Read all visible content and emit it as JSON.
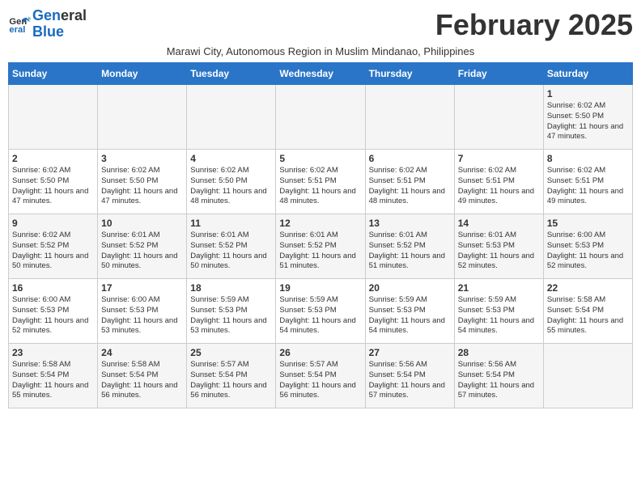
{
  "logo": {
    "line1": "General",
    "line2": "Blue"
  },
  "title": "February 2025",
  "subtitle": "Marawi City, Autonomous Region in Muslim Mindanao, Philippines",
  "days_of_week": [
    "Sunday",
    "Monday",
    "Tuesday",
    "Wednesday",
    "Thursday",
    "Friday",
    "Saturday"
  ],
  "weeks": [
    [
      {
        "day": "",
        "info": ""
      },
      {
        "day": "",
        "info": ""
      },
      {
        "day": "",
        "info": ""
      },
      {
        "day": "",
        "info": ""
      },
      {
        "day": "",
        "info": ""
      },
      {
        "day": "",
        "info": ""
      },
      {
        "day": "1",
        "info": "Sunrise: 6:02 AM\nSunset: 5:50 PM\nDaylight: 11 hours and 47 minutes."
      }
    ],
    [
      {
        "day": "2",
        "info": "Sunrise: 6:02 AM\nSunset: 5:50 PM\nDaylight: 11 hours and 47 minutes."
      },
      {
        "day": "3",
        "info": "Sunrise: 6:02 AM\nSunset: 5:50 PM\nDaylight: 11 hours and 47 minutes."
      },
      {
        "day": "4",
        "info": "Sunrise: 6:02 AM\nSunset: 5:50 PM\nDaylight: 11 hours and 48 minutes."
      },
      {
        "day": "5",
        "info": "Sunrise: 6:02 AM\nSunset: 5:51 PM\nDaylight: 11 hours and 48 minutes."
      },
      {
        "day": "6",
        "info": "Sunrise: 6:02 AM\nSunset: 5:51 PM\nDaylight: 11 hours and 48 minutes."
      },
      {
        "day": "7",
        "info": "Sunrise: 6:02 AM\nSunset: 5:51 PM\nDaylight: 11 hours and 49 minutes."
      },
      {
        "day": "8",
        "info": "Sunrise: 6:02 AM\nSunset: 5:51 PM\nDaylight: 11 hours and 49 minutes."
      }
    ],
    [
      {
        "day": "9",
        "info": "Sunrise: 6:02 AM\nSunset: 5:52 PM\nDaylight: 11 hours and 50 minutes."
      },
      {
        "day": "10",
        "info": "Sunrise: 6:01 AM\nSunset: 5:52 PM\nDaylight: 11 hours and 50 minutes."
      },
      {
        "day": "11",
        "info": "Sunrise: 6:01 AM\nSunset: 5:52 PM\nDaylight: 11 hours and 50 minutes."
      },
      {
        "day": "12",
        "info": "Sunrise: 6:01 AM\nSunset: 5:52 PM\nDaylight: 11 hours and 51 minutes."
      },
      {
        "day": "13",
        "info": "Sunrise: 6:01 AM\nSunset: 5:52 PM\nDaylight: 11 hours and 51 minutes."
      },
      {
        "day": "14",
        "info": "Sunrise: 6:01 AM\nSunset: 5:53 PM\nDaylight: 11 hours and 52 minutes."
      },
      {
        "day": "15",
        "info": "Sunrise: 6:00 AM\nSunset: 5:53 PM\nDaylight: 11 hours and 52 minutes."
      }
    ],
    [
      {
        "day": "16",
        "info": "Sunrise: 6:00 AM\nSunset: 5:53 PM\nDaylight: 11 hours and 52 minutes."
      },
      {
        "day": "17",
        "info": "Sunrise: 6:00 AM\nSunset: 5:53 PM\nDaylight: 11 hours and 53 minutes."
      },
      {
        "day": "18",
        "info": "Sunrise: 5:59 AM\nSunset: 5:53 PM\nDaylight: 11 hours and 53 minutes."
      },
      {
        "day": "19",
        "info": "Sunrise: 5:59 AM\nSunset: 5:53 PM\nDaylight: 11 hours and 54 minutes."
      },
      {
        "day": "20",
        "info": "Sunrise: 5:59 AM\nSunset: 5:53 PM\nDaylight: 11 hours and 54 minutes."
      },
      {
        "day": "21",
        "info": "Sunrise: 5:59 AM\nSunset: 5:53 PM\nDaylight: 11 hours and 54 minutes."
      },
      {
        "day": "22",
        "info": "Sunrise: 5:58 AM\nSunset: 5:54 PM\nDaylight: 11 hours and 55 minutes."
      }
    ],
    [
      {
        "day": "23",
        "info": "Sunrise: 5:58 AM\nSunset: 5:54 PM\nDaylight: 11 hours and 55 minutes."
      },
      {
        "day": "24",
        "info": "Sunrise: 5:58 AM\nSunset: 5:54 PM\nDaylight: 11 hours and 56 minutes."
      },
      {
        "day": "25",
        "info": "Sunrise: 5:57 AM\nSunset: 5:54 PM\nDaylight: 11 hours and 56 minutes."
      },
      {
        "day": "26",
        "info": "Sunrise: 5:57 AM\nSunset: 5:54 PM\nDaylight: 11 hours and 56 minutes."
      },
      {
        "day": "27",
        "info": "Sunrise: 5:56 AM\nSunset: 5:54 PM\nDaylight: 11 hours and 57 minutes."
      },
      {
        "day": "28",
        "info": "Sunrise: 5:56 AM\nSunset: 5:54 PM\nDaylight: 11 hours and 57 minutes."
      },
      {
        "day": "",
        "info": ""
      }
    ]
  ]
}
